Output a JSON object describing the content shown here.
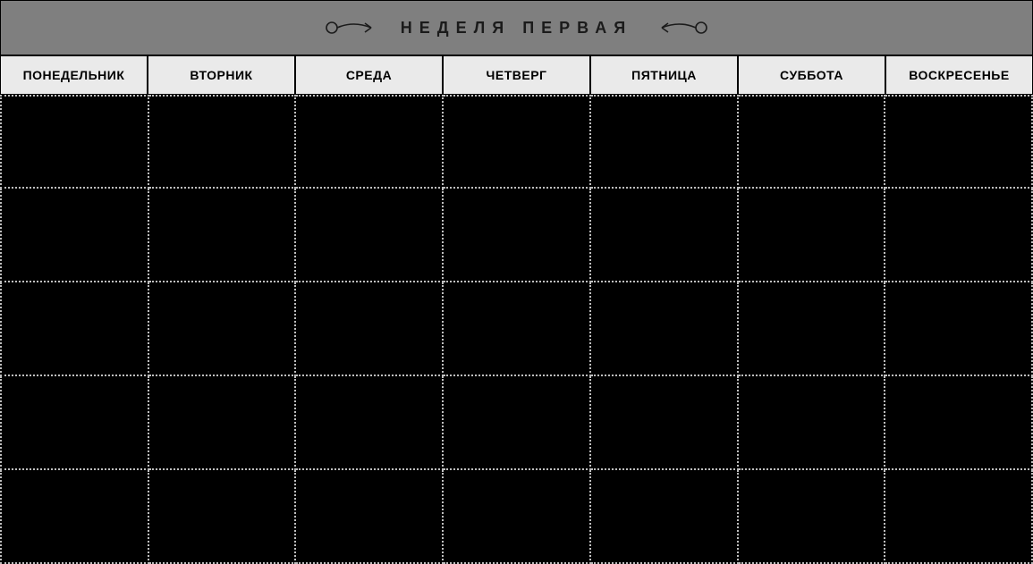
{
  "title": "НЕДЕЛЯ ПЕРВАЯ",
  "days": [
    "ПОНЕДЕЛЬНИК",
    "ВТОРНИК",
    "СРЕДА",
    "ЧЕТВЕРГ",
    "ПЯТНИЦА",
    "СУББОТА",
    "ВОСКРЕСЕНЬЕ"
  ],
  "rows": 5
}
